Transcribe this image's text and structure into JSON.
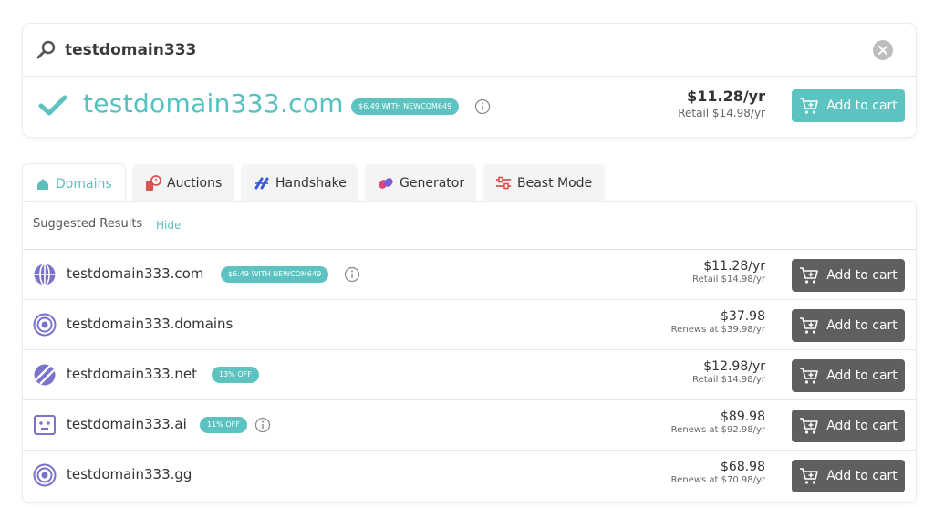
{
  "search": {
    "query": "testdomain333"
  },
  "hero": {
    "domain": "testdomain333.com",
    "promo": "$6.49 WITH NEWCOM649",
    "price": "$11.28/yr",
    "retail": "Retail $14.98/yr",
    "cart_label": "Add to cart"
  },
  "tabs": [
    {
      "label": "Domains",
      "icon": "home-icon"
    },
    {
      "label": "Auctions",
      "icon": "auction-icon"
    },
    {
      "label": "Handshake",
      "icon": "handshake-icon"
    },
    {
      "label": "Generator",
      "icon": "generator-icon"
    },
    {
      "label": "Beast Mode",
      "icon": "sliders-icon"
    }
  ],
  "suggested": {
    "label": "Suggested Results",
    "hide_label": "Hide"
  },
  "rows": [
    {
      "name": "testdomain333.com",
      "badge": "$6.49 WITH NEWCOM649",
      "price": "$11.28/yr",
      "sub": "Retail $14.98/yr",
      "cart_label": "Add to cart",
      "icon": "globe-icon"
    },
    {
      "name": "testdomain333.domains",
      "badge": "",
      "price": "$37.98",
      "sub": "Renews at $39.98/yr",
      "cart_label": "Add to cart",
      "icon": "target-icon"
    },
    {
      "name": "testdomain333.net",
      "badge": "13% OFF",
      "price": "$12.98/yr",
      "sub": "Retail $14.98/yr",
      "cart_label": "Add to cart",
      "icon": "net-icon"
    },
    {
      "name": "testdomain333.ai",
      "badge": "11% OFF",
      "price": "$89.98",
      "sub": "Renews at $92.98/yr",
      "cart_label": "Add to cart",
      "icon": "robot-icon"
    },
    {
      "name": "testdomain333.gg",
      "badge": "",
      "price": "$68.98",
      "sub": "Renews at $70.98/yr",
      "cart_label": "Add to cart",
      "icon": "target-icon"
    }
  ],
  "colors": {
    "accent": "#5cc3c0",
    "button_dark": "#5f5f5f",
    "icon_purple": "#7b73c9"
  }
}
